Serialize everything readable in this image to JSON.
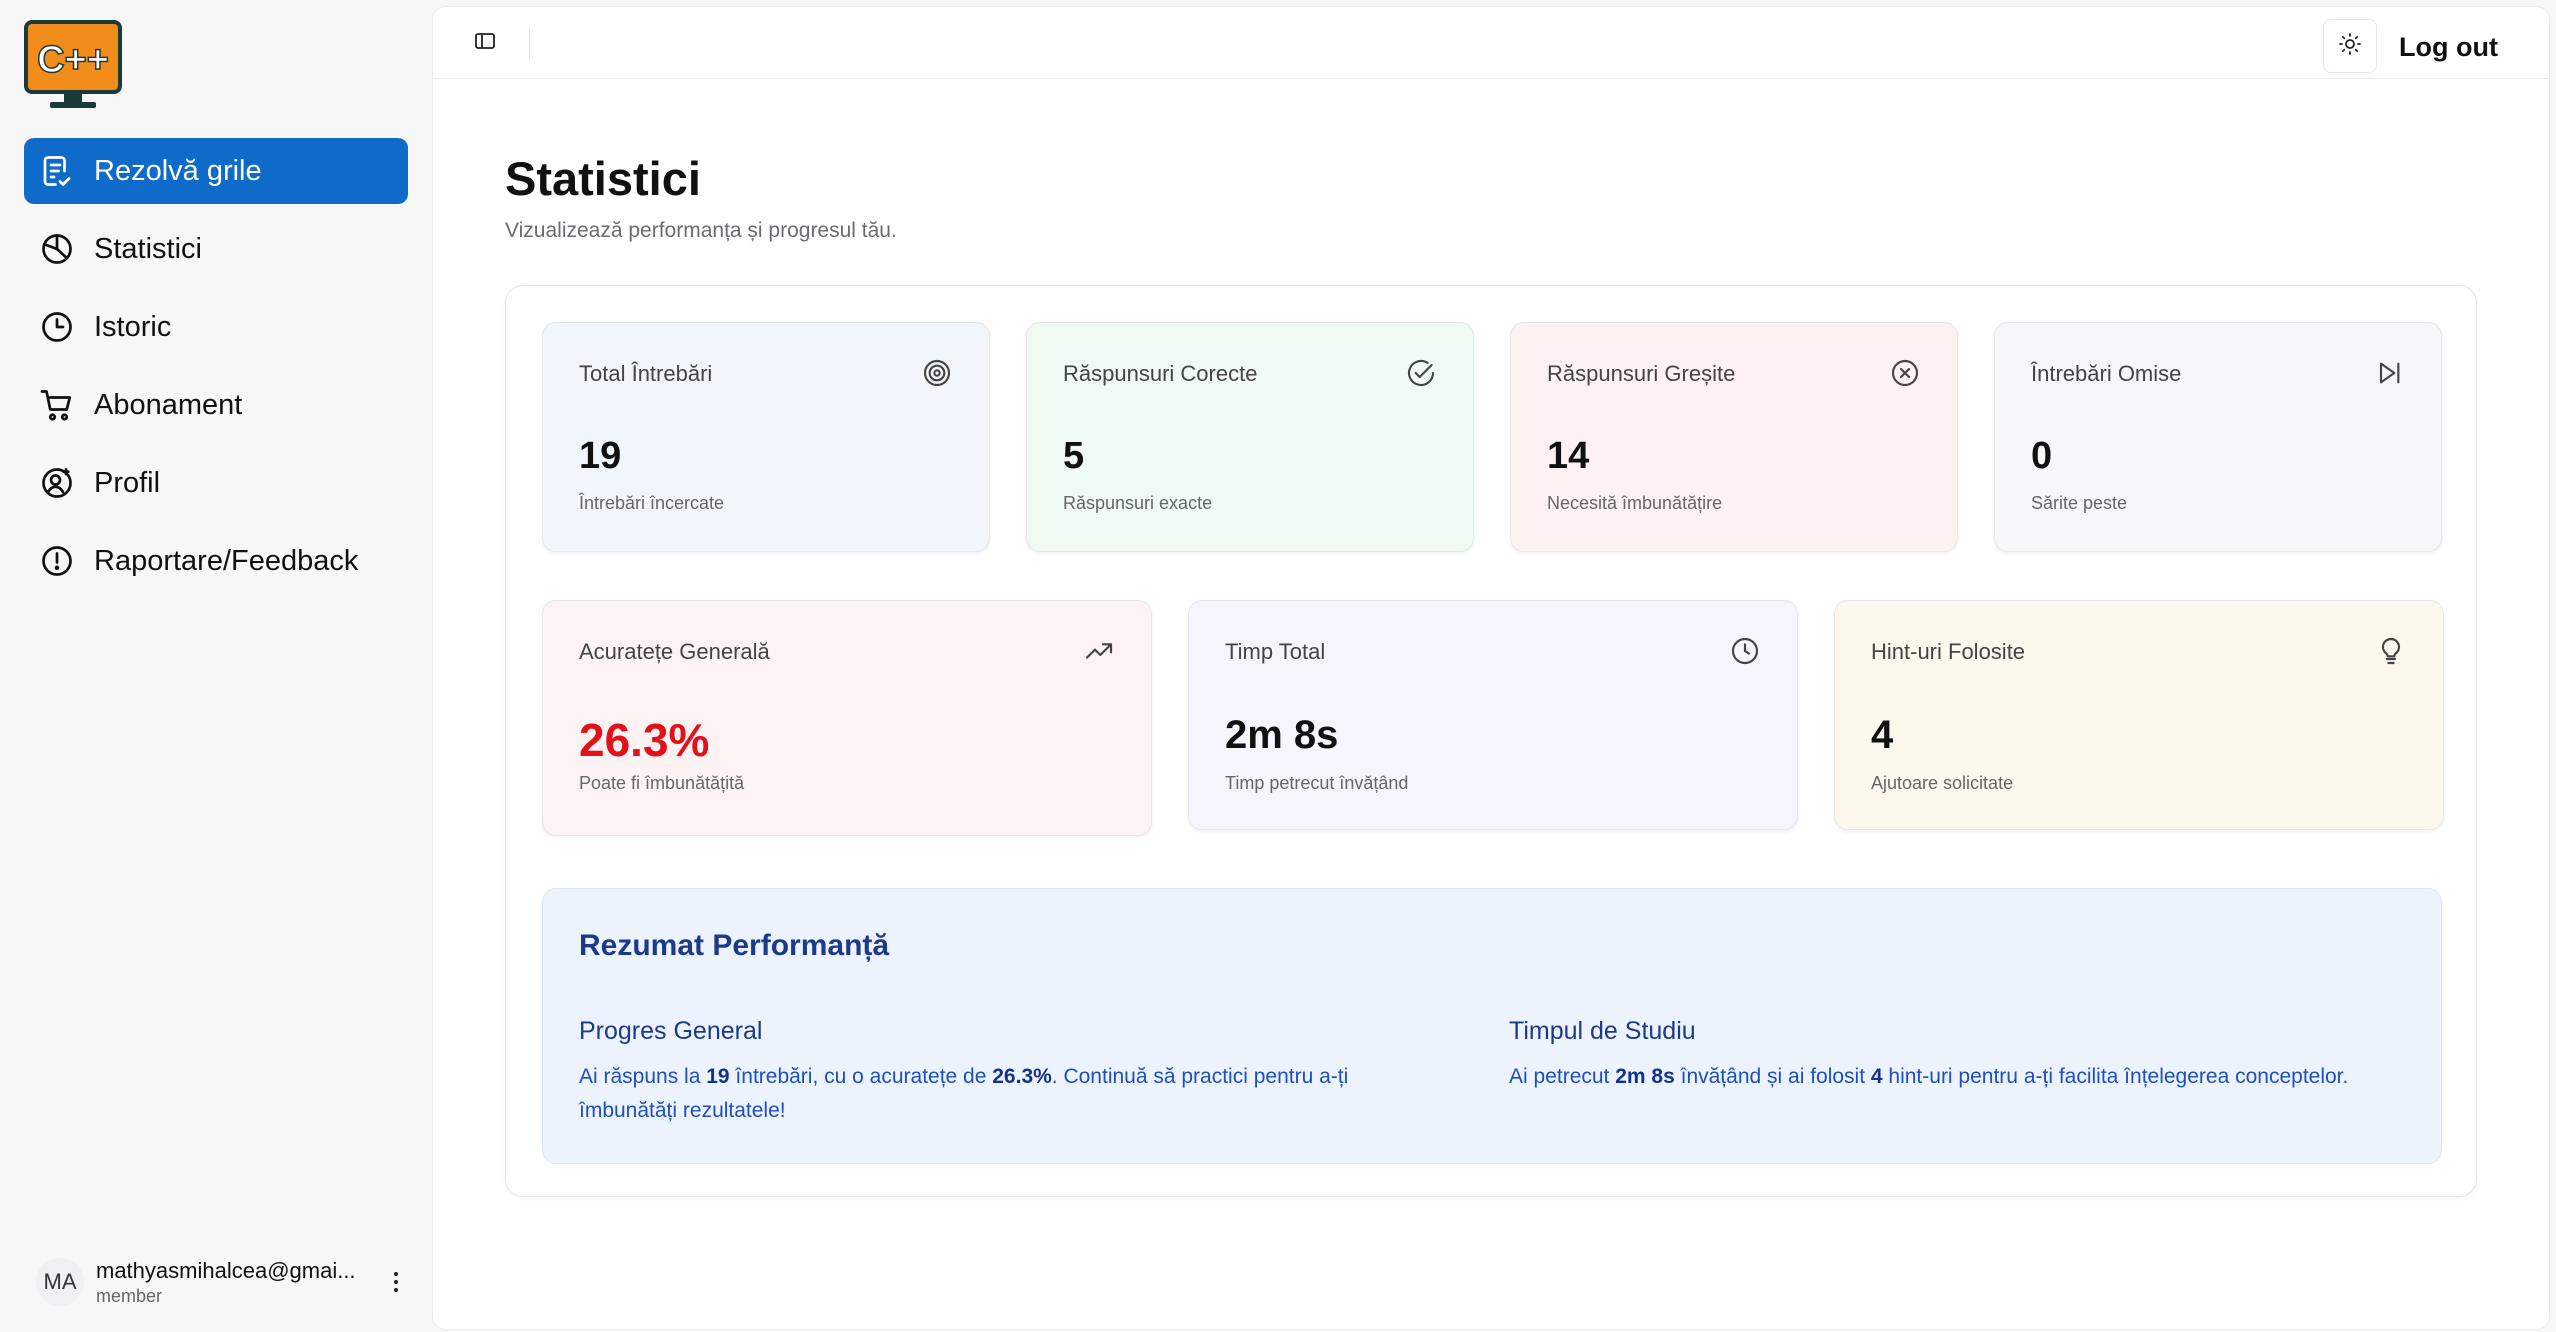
{
  "app": {
    "logo_text": "C++"
  },
  "sidebar": {
    "items": [
      {
        "label": "Rezolvă grile",
        "icon": "quiz-icon",
        "active": true
      },
      {
        "label": "Statistici",
        "icon": "pie-chart-icon"
      },
      {
        "label": "Istoric",
        "icon": "clock-icon"
      },
      {
        "label": "Abonament",
        "icon": "cart-icon"
      },
      {
        "label": "Profil",
        "icon": "user-settings-icon"
      },
      {
        "label": "Raportare/Feedback",
        "icon": "alert-circle-icon"
      }
    ],
    "user": {
      "initials": "MA",
      "email": "mathyasmihalcea@gmai...",
      "role": "member"
    }
  },
  "topbar": {
    "logout_label": "Log out"
  },
  "page": {
    "title": "Statistici",
    "subtitle": "Vizualizează performanța și progresul tău."
  },
  "stats_row1": [
    {
      "label": "Total Întrebări",
      "value": "19",
      "sub": "Întrebări încercate",
      "icon": "target-icon"
    },
    {
      "label": "Răspunsuri Corecte",
      "value": "5",
      "sub": "Răspunsuri exacte",
      "icon": "check-circle-icon"
    },
    {
      "label": "Răspunsuri Greșite",
      "value": "14",
      "sub": "Necesită îmbunătățire",
      "icon": "x-circle-icon"
    },
    {
      "label": "Întrebări Omise",
      "value": "0",
      "sub": "Sărite peste",
      "icon": "skip-forward-icon"
    }
  ],
  "stats_row2": [
    {
      "label": "Acuratețe Generală",
      "value": "26.3%",
      "sub": "Poate fi îmbunătățită",
      "icon": "trending-up-icon"
    },
    {
      "label": "Timp Total",
      "value": "2m 8s",
      "sub": "Timp petrecut învățând",
      "icon": "clock-icon"
    },
    {
      "label": "Hint-uri Folosite",
      "value": "4",
      "sub": "Ajutoare solicitate",
      "icon": "lightbulb-icon"
    }
  ],
  "summary": {
    "title": "Rezumat Performanță",
    "progress": {
      "heading": "Progres General",
      "t1": "Ai răspuns la ",
      "n1": "19",
      "t2": " întrebări, cu o acuratețe de ",
      "n2": "26.3%",
      "t3": ". Continuă să practici pentru a-ți îmbunătăți rezultatele!"
    },
    "study": {
      "heading": "Timpul de Studiu",
      "t1": "Ai petrecut ",
      "n1": "2m 8s",
      "t2": " învățând și ai folosit ",
      "n2": "4",
      "t3": " hint-uri pentru a-ți facilita înțelegerea conceptelor."
    }
  },
  "colors": {
    "accent": "#0f6bc9",
    "accuracy_red": "#e3101a",
    "summary_blue": "#1b3a8a"
  }
}
